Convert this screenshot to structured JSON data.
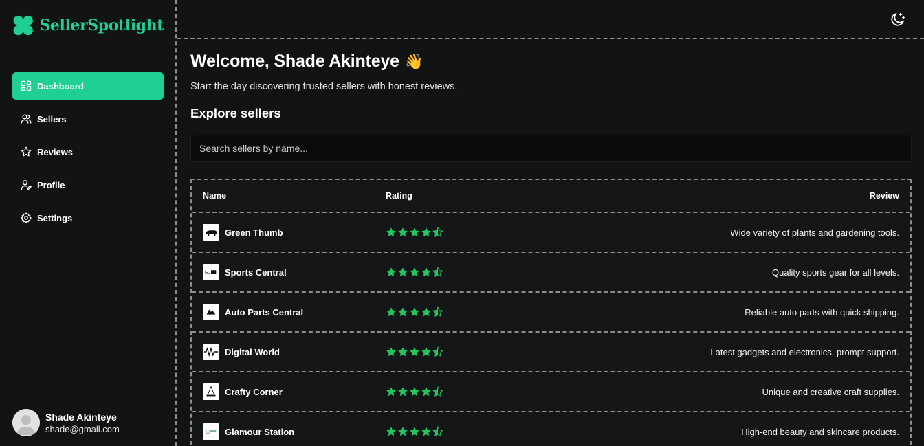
{
  "brand": {
    "name": "SellerSpotlight",
    "accent": "#1fcf94"
  },
  "nav": [
    {
      "label": "Dashboard",
      "icon": "grid-icon",
      "active": true
    },
    {
      "label": "Sellers",
      "icon": "users-icon",
      "active": false
    },
    {
      "label": "Reviews",
      "icon": "star-outline-icon",
      "active": false
    },
    {
      "label": "Profile",
      "icon": "user-edit-icon",
      "active": false
    },
    {
      "label": "Settings",
      "icon": "gear-icon",
      "active": false
    }
  ],
  "user": {
    "name": "Shade Akinteye",
    "email": "shade@gmail.com"
  },
  "header": {
    "theme_icon": "moon-icon"
  },
  "main": {
    "welcome": "Welcome, Shade Akinteye",
    "wave": "👋",
    "subtitle": "Start the day discovering trusted sellers with honest reviews.",
    "section_title": "Explore sellers",
    "search_placeholder": "Search sellers by name..."
  },
  "table": {
    "headers": {
      "name": "Name",
      "rating": "Rating",
      "review": "Review"
    },
    "star_color": "#22c55e",
    "rows": [
      {
        "name": "Green Thumb",
        "rating": 4.5,
        "review": "Wide variety of plants and gardening tools."
      },
      {
        "name": "Sports Central",
        "rating": 4.5,
        "review": "Quality sports gear for all levels."
      },
      {
        "name": "Auto Parts Central",
        "rating": 4.5,
        "review": "Reliable auto parts with quick shipping."
      },
      {
        "name": "Digital World",
        "rating": 4.5,
        "review": "Latest gadgets and electronics, prompt support."
      },
      {
        "name": "Crafty Corner",
        "rating": 4.5,
        "review": "Unique and creative craft supplies."
      },
      {
        "name": "Glamour Station",
        "rating": 4.5,
        "review": "High-end beauty and skincare products."
      }
    ]
  }
}
